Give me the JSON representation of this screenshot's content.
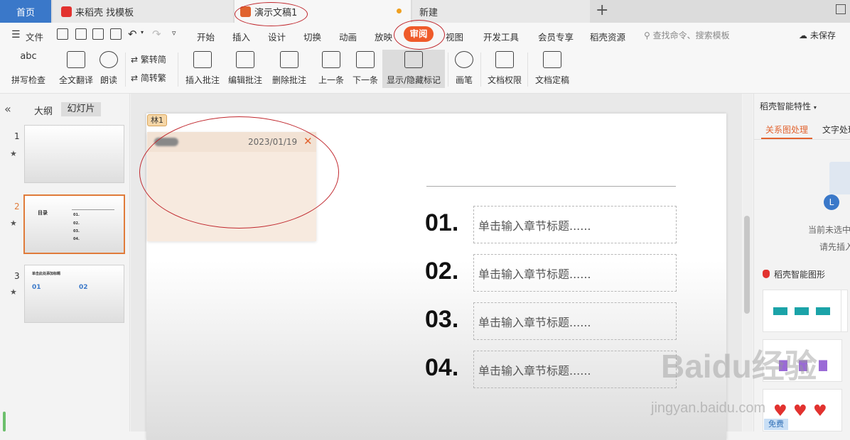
{
  "tabs": {
    "home": "首页",
    "daoke": "来稻壳 找模板",
    "document": "演示文稿1",
    "new": "新建",
    "plus": "+"
  },
  "menu": {
    "file": "文件",
    "items": [
      "开始",
      "插入",
      "设计",
      "切换",
      "动画",
      "放映",
      "审阅",
      "视图",
      "开发工具",
      "会员专享",
      "稻壳资源"
    ],
    "search_placeholder": "查找命令、搜索模板",
    "unsaved": "未保存"
  },
  "ribbon": {
    "spell_check": "拼写检查",
    "spell_icon": "abc",
    "full_translate": "全文翻译",
    "read_aloud": "朗读",
    "trad_simp": "繁转简",
    "simp_trad": "简转繁",
    "insert_comment": "插入批注",
    "edit_comment": "编辑批注",
    "delete_comment": "删除批注",
    "prev": "上一条",
    "next": "下一条",
    "show_hide_marks": "显示/隐藏标记",
    "pen": "画笔",
    "doc_permission": "文档权限",
    "doc_final": "文档定稿"
  },
  "left_panel": {
    "collapse": "«",
    "outline_tab": "大纲",
    "slides_tab": "幻灯片",
    "thumbnails": [
      {
        "num": "1",
        "star": "★"
      },
      {
        "num": "2",
        "star": "★",
        "title": "目录",
        "items": [
          "01.",
          "02.",
          "03.",
          "04."
        ]
      },
      {
        "num": "3",
        "star": "★",
        "title": "单击此处添加标题",
        "nums": [
          "01",
          "02"
        ]
      }
    ]
  },
  "comment": {
    "author_tag": "林1",
    "date": "2023/01/19",
    "close": "✕"
  },
  "slide": {
    "sections": [
      {
        "num": "01.",
        "placeholder": "单击输入章节标题......"
      },
      {
        "num": "02.",
        "placeholder": "单击输入章节标题......"
      },
      {
        "num": "03.",
        "placeholder": "单击输入章节标题......"
      },
      {
        "num": "04.",
        "placeholder": "单击输入章节标题......"
      }
    ]
  },
  "right_panel": {
    "title": "稻壳智能特性",
    "tab_relation": "关系图处理",
    "tab_text": "文字处理",
    "msg1": "当前未选中",
    "msg2": "请先插入",
    "section": "稻壳智能图形",
    "free_badge": "免费"
  },
  "watermark": {
    "brand": "Baidu经验",
    "url": "jingyan.baidu.com"
  },
  "colors": {
    "accent": "#ef5b2a",
    "tab_home": "#3a78c9",
    "annotation_circle": "#c0272d",
    "comment_bg": "#f7eadf"
  }
}
